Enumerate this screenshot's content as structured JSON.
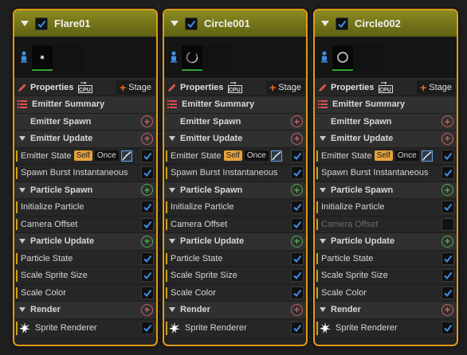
{
  "emitters": [
    {
      "name": "Flare01",
      "properties_label": "Properties",
      "cpu_label": "CPU",
      "stage_label": "Stage",
      "emitter_summary": "Emitter Summary",
      "emitter_spawn": "Emitter Spawn",
      "emitter_update": "Emitter Update",
      "emitter_state": "Emitter State",
      "self_badge": "Self",
      "once_badge": "Once",
      "spawn_burst": "Spawn Burst Instantaneous",
      "particle_spawn": "Particle Spawn",
      "initialize_particle": "Initialize Particle",
      "camera_offset": "Camera Offset",
      "particle_update": "Particle Update",
      "particle_state": "Particle State",
      "scale_sprite_size": "Scale Sprite Size",
      "scale_color": "Scale Color",
      "render": "Render",
      "sprite_renderer": "Sprite Renderer",
      "camera_offset_enabled": true
    },
    {
      "name": "Circle001",
      "properties_label": "Properties",
      "cpu_label": "CPU",
      "stage_label": "Stage",
      "emitter_summary": "Emitter Summary",
      "emitter_spawn": "Emitter Spawn",
      "emitter_update": "Emitter Update",
      "emitter_state": "Emitter State",
      "self_badge": "Self",
      "once_badge": "Once",
      "spawn_burst": "Spawn Burst Instantaneous",
      "particle_spawn": "Particle Spawn",
      "initialize_particle": "Initialize Particle",
      "camera_offset": "Camera Offset",
      "particle_update": "Particle Update",
      "particle_state": "Particle State",
      "scale_sprite_size": "Scale Sprite Size",
      "scale_color": "Scale Color",
      "render": "Render",
      "sprite_renderer": "Sprite Renderer",
      "camera_offset_enabled": true
    },
    {
      "name": "Circle002",
      "properties_label": "Properties",
      "cpu_label": "CPU",
      "stage_label": "Stage",
      "emitter_summary": "Emitter Summary",
      "emitter_spawn": "Emitter Spawn",
      "emitter_update": "Emitter Update",
      "emitter_state": "Emitter State",
      "self_badge": "Self",
      "once_badge": "Once",
      "spawn_burst": "Spawn Burst Instantaneous",
      "particle_spawn": "Particle Spawn",
      "initialize_particle": "Initialize Particle",
      "camera_offset": "Camera Offset",
      "particle_update": "Particle Update",
      "particle_state": "Particle State",
      "scale_sprite_size": "Scale Sprite Size",
      "scale_color": "Scale Color",
      "render": "Render",
      "sprite_renderer": "Sprite Renderer",
      "camera_offset_enabled": false
    }
  ],
  "colors": {
    "selection_border": "#e39a1a",
    "header_olive": "#8a8b1f",
    "checkbox_blue": "#3d8ee8",
    "module_accent": "#c9a01a",
    "add_red": "#c86262",
    "add_green": "#4fae4f",
    "stage_plus": "#ee6a19"
  }
}
